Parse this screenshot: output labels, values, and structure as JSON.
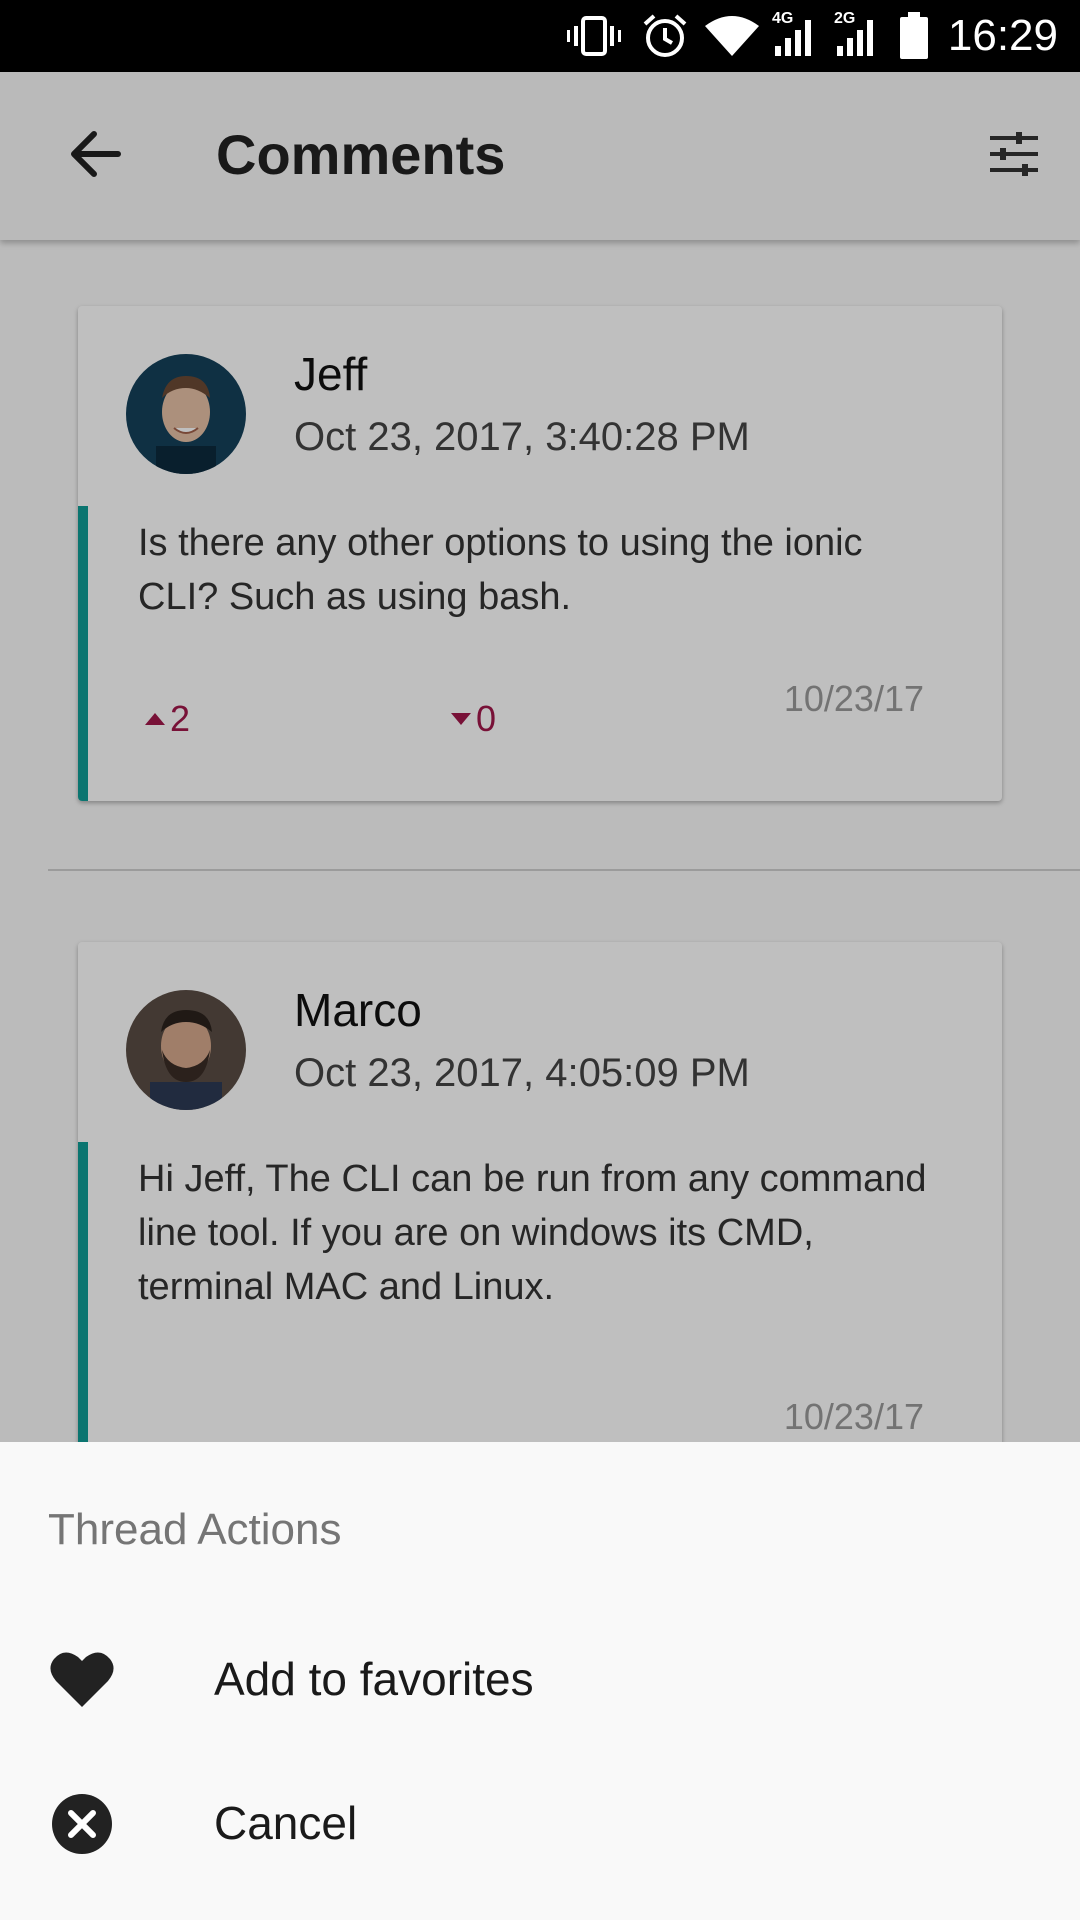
{
  "status_bar": {
    "time": "16:29",
    "network_1": "4G",
    "network_2": "2G",
    "icons": [
      "vibrate-icon",
      "alarm-icon",
      "wifi-icon",
      "signal-4g-icon",
      "signal-2g-icon",
      "battery-icon"
    ]
  },
  "toolbar": {
    "title": "Comments",
    "back_icon": "arrow-back-icon",
    "filter_icon": "sliders-icon"
  },
  "comments": [
    {
      "author": "Jeff",
      "date": "Oct 23, 2017, 3:40:28 PM",
      "text": "Is there any other options to using the ionic CLI? Such as using bash.",
      "upvotes": "2",
      "downvotes": "0",
      "short_date": "10/23/17"
    },
    {
      "author": "Marco",
      "date": "Oct 23, 2017, 4:05:09 PM",
      "text": "Hi Jeff, The CLI can be run from any command line tool. If you are on windows its CMD, terminal MAC and Linux.",
      "short_date": "10/23/17"
    }
  ],
  "action_sheet": {
    "title": "Thread Actions",
    "buttons": [
      {
        "label": "Add to favorites",
        "icon": "heart-icon"
      },
      {
        "label": "Cancel",
        "icon": "close-circle-icon"
      }
    ]
  },
  "colors": {
    "accent": "#0f9d96",
    "vote": "#a0174a"
  }
}
